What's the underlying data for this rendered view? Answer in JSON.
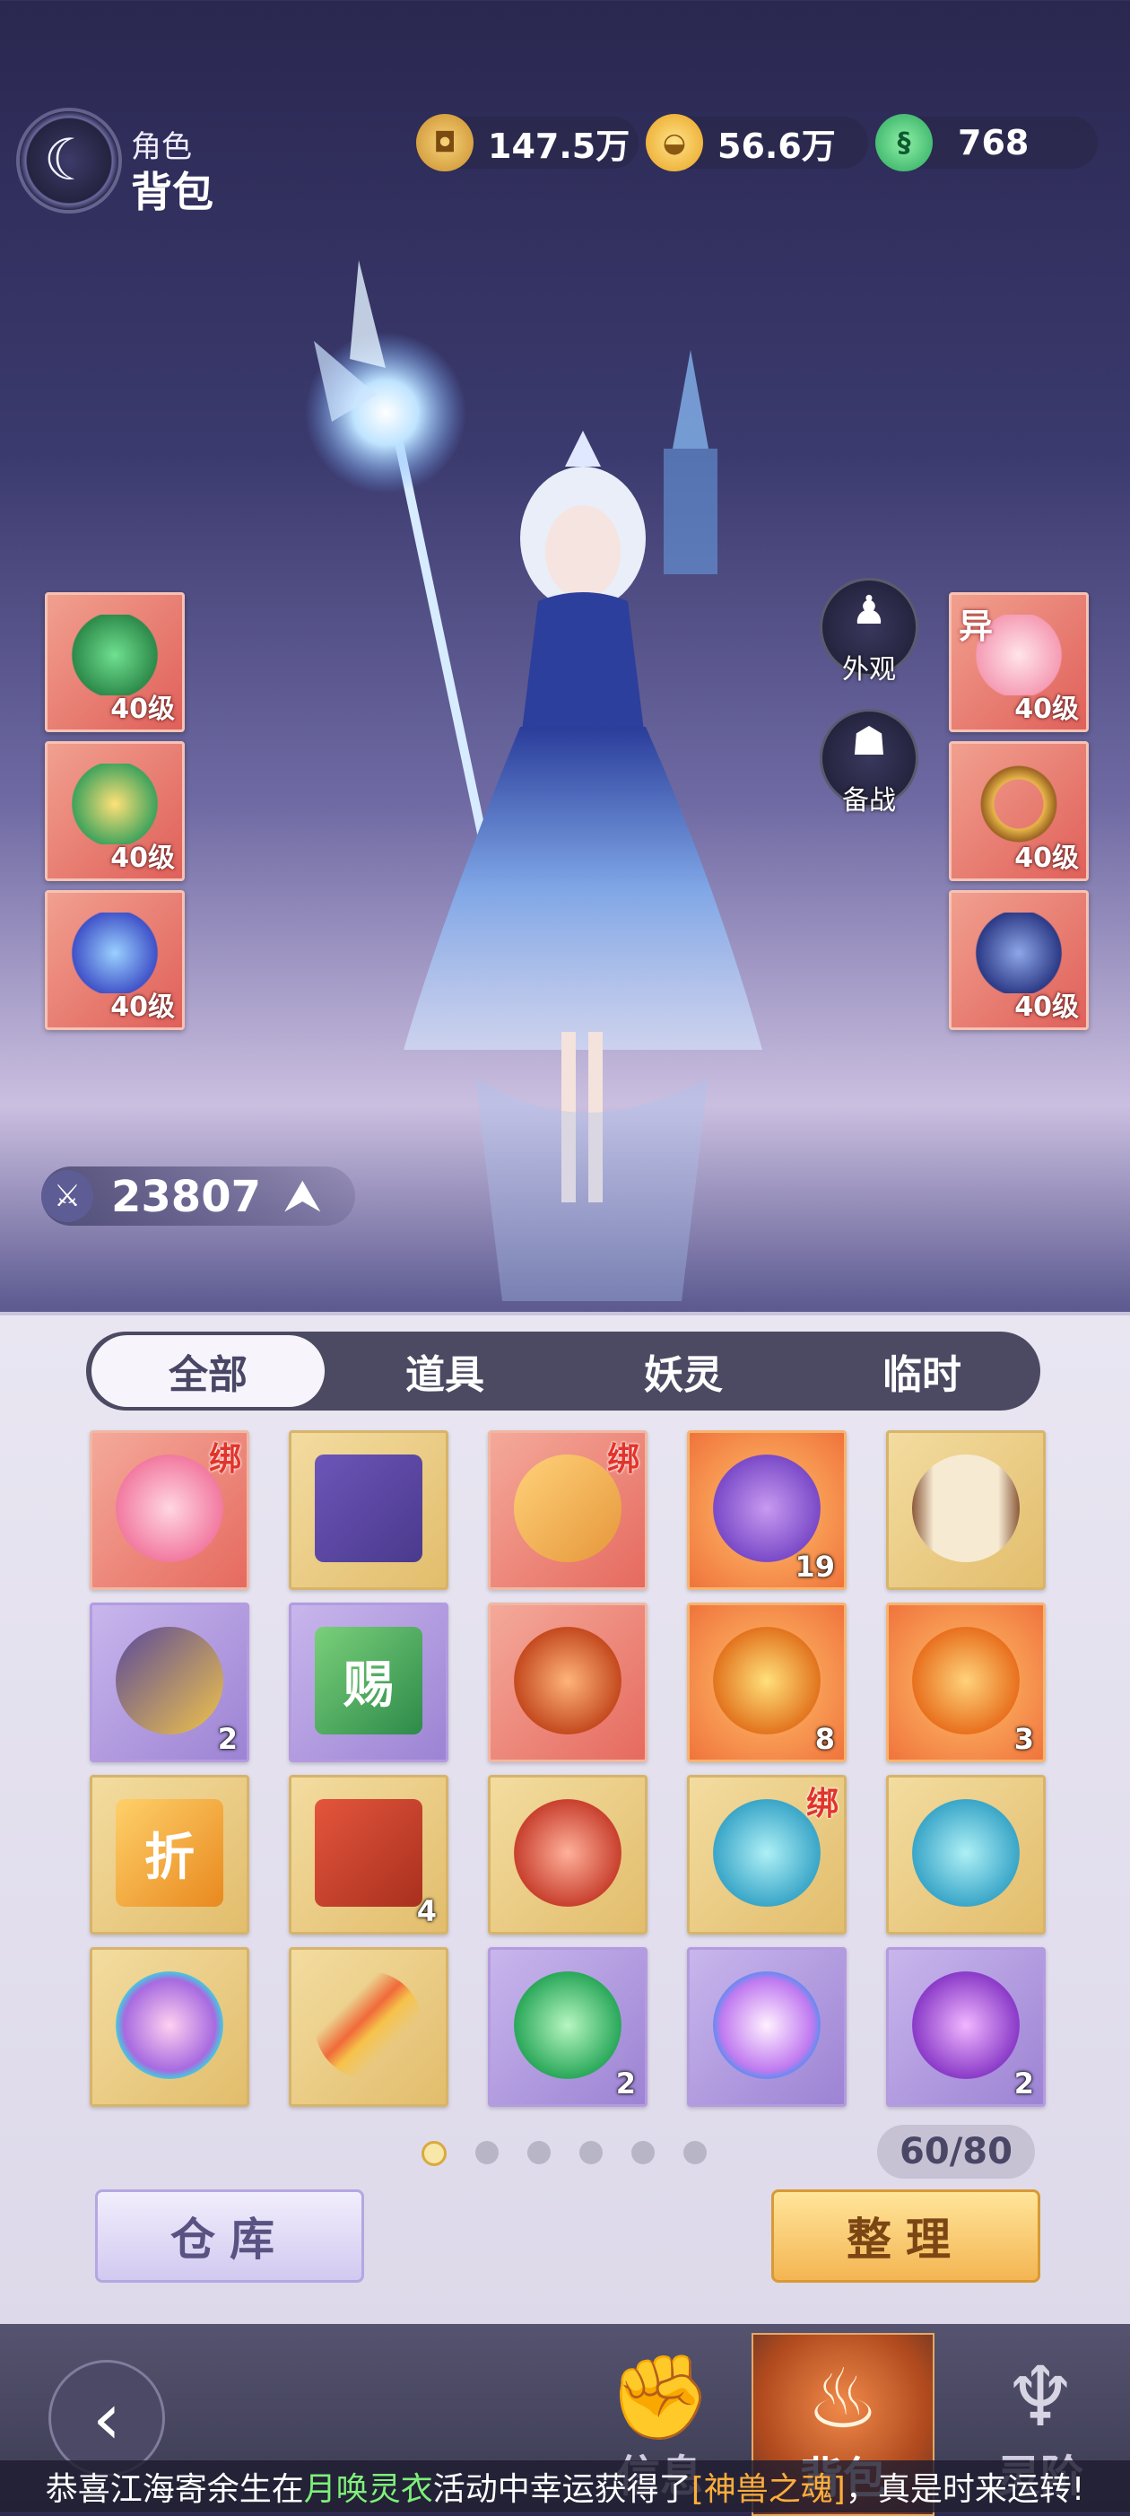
{
  "header": {
    "crumb_small": "角色",
    "crumb_big": "背包",
    "logo_icon": "crescent-moon-icon"
  },
  "currencies": [
    {
      "name": "copper-coin",
      "value": "147.5万",
      "color": "#d8a53a"
    },
    {
      "name": "gold-ingot",
      "value": "56.6万",
      "color": "#f4c438"
    },
    {
      "name": "jade",
      "value": "768",
      "color": "#47c27a"
    }
  ],
  "equipment": {
    "left": [
      {
        "level": "40级",
        "icon": "jade-pendant-icon"
      },
      {
        "level": "40级",
        "icon": "amulet-icon"
      },
      {
        "level": "40级",
        "icon": "blue-pendant-icon"
      }
    ],
    "right": [
      {
        "level": "40级",
        "icon": "flower-crown-icon",
        "tag": "异"
      },
      {
        "level": "40级",
        "icon": "bracelet-icon"
      },
      {
        "level": "40级",
        "icon": "boots-icon"
      }
    ]
  },
  "side_buttons": {
    "appearance": "外观",
    "standby": "备战"
  },
  "power": {
    "value": "23807",
    "arrow": "⮝"
  },
  "tabs": [
    "全部",
    "道具",
    "妖灵",
    "临时"
  ],
  "active_tab": 0,
  "items": [
    {
      "rarity": "red",
      "icon": "lotus-icon",
      "bind": "绑",
      "count": ""
    },
    {
      "rarity": "gold",
      "icon": "card-deck-icon",
      "bind": "",
      "count": ""
    },
    {
      "rarity": "red",
      "icon": "gift-box-icon",
      "bind": "绑",
      "count": ""
    },
    {
      "rarity": "orange",
      "icon": "treasure-bag-icon",
      "bind": "",
      "count": "19"
    },
    {
      "rarity": "gold",
      "icon": "scroll-icon",
      "bind": "",
      "count": ""
    },
    {
      "rarity": "purple",
      "icon": "treasure-chest-icon",
      "bind": "",
      "count": "2"
    },
    {
      "rarity": "purple",
      "icon": "gift-card-icon",
      "bind": "",
      "count": "",
      "glyph": "赐"
    },
    {
      "rarity": "red",
      "icon": "pig-orb-icon",
      "bind": "",
      "count": ""
    },
    {
      "rarity": "orange",
      "icon": "bell-token-icon",
      "bind": "",
      "count": "8"
    },
    {
      "rarity": "orange",
      "icon": "fox-orb-icon",
      "bind": "",
      "count": "3"
    },
    {
      "rarity": "gold",
      "icon": "discount-card-icon",
      "bind": "",
      "count": "",
      "glyph": "折"
    },
    {
      "rarity": "gold",
      "icon": "taiji-book-icon",
      "bind": "",
      "count": "4"
    },
    {
      "rarity": "gold",
      "icon": "spiral-orb-icon",
      "bind": "",
      "count": ""
    },
    {
      "rarity": "gold",
      "icon": "blue-orb-icon",
      "bind": "绑",
      "count": ""
    },
    {
      "rarity": "gold",
      "icon": "blue-orb-icon",
      "bind": "",
      "count": ""
    },
    {
      "rarity": "gold",
      "icon": "rainbow-fruit-icon",
      "bind": "",
      "count": ""
    },
    {
      "rarity": "gold",
      "icon": "phoenix-feather-icon",
      "bind": "",
      "count": ""
    },
    {
      "rarity": "purple",
      "icon": "green-gem-icon",
      "bind": "",
      "count": "2"
    },
    {
      "rarity": "purple",
      "icon": "diamond-gem-icon",
      "bind": "",
      "count": ""
    },
    {
      "rarity": "purple",
      "icon": "purple-orb-icon",
      "bind": "",
      "count": "2"
    }
  ],
  "pagination": {
    "pages": 6,
    "current": 0
  },
  "capacity": "60/80",
  "buttons": {
    "storage": "仓库",
    "sort": "整理"
  },
  "nav": [
    {
      "label": "信息",
      "icon": "fist-icon"
    },
    {
      "label": "背包",
      "icon": "bag-icon"
    },
    {
      "label": "灵阶",
      "icon": "flame-icon"
    }
  ],
  "ticker": {
    "pre": "恭喜江海寄余生在",
    "activity": "月唤灵衣",
    "mid": "活动中幸运获得了",
    "reward": "[神兽之魂]",
    "post": "，真是时来运转!"
  }
}
